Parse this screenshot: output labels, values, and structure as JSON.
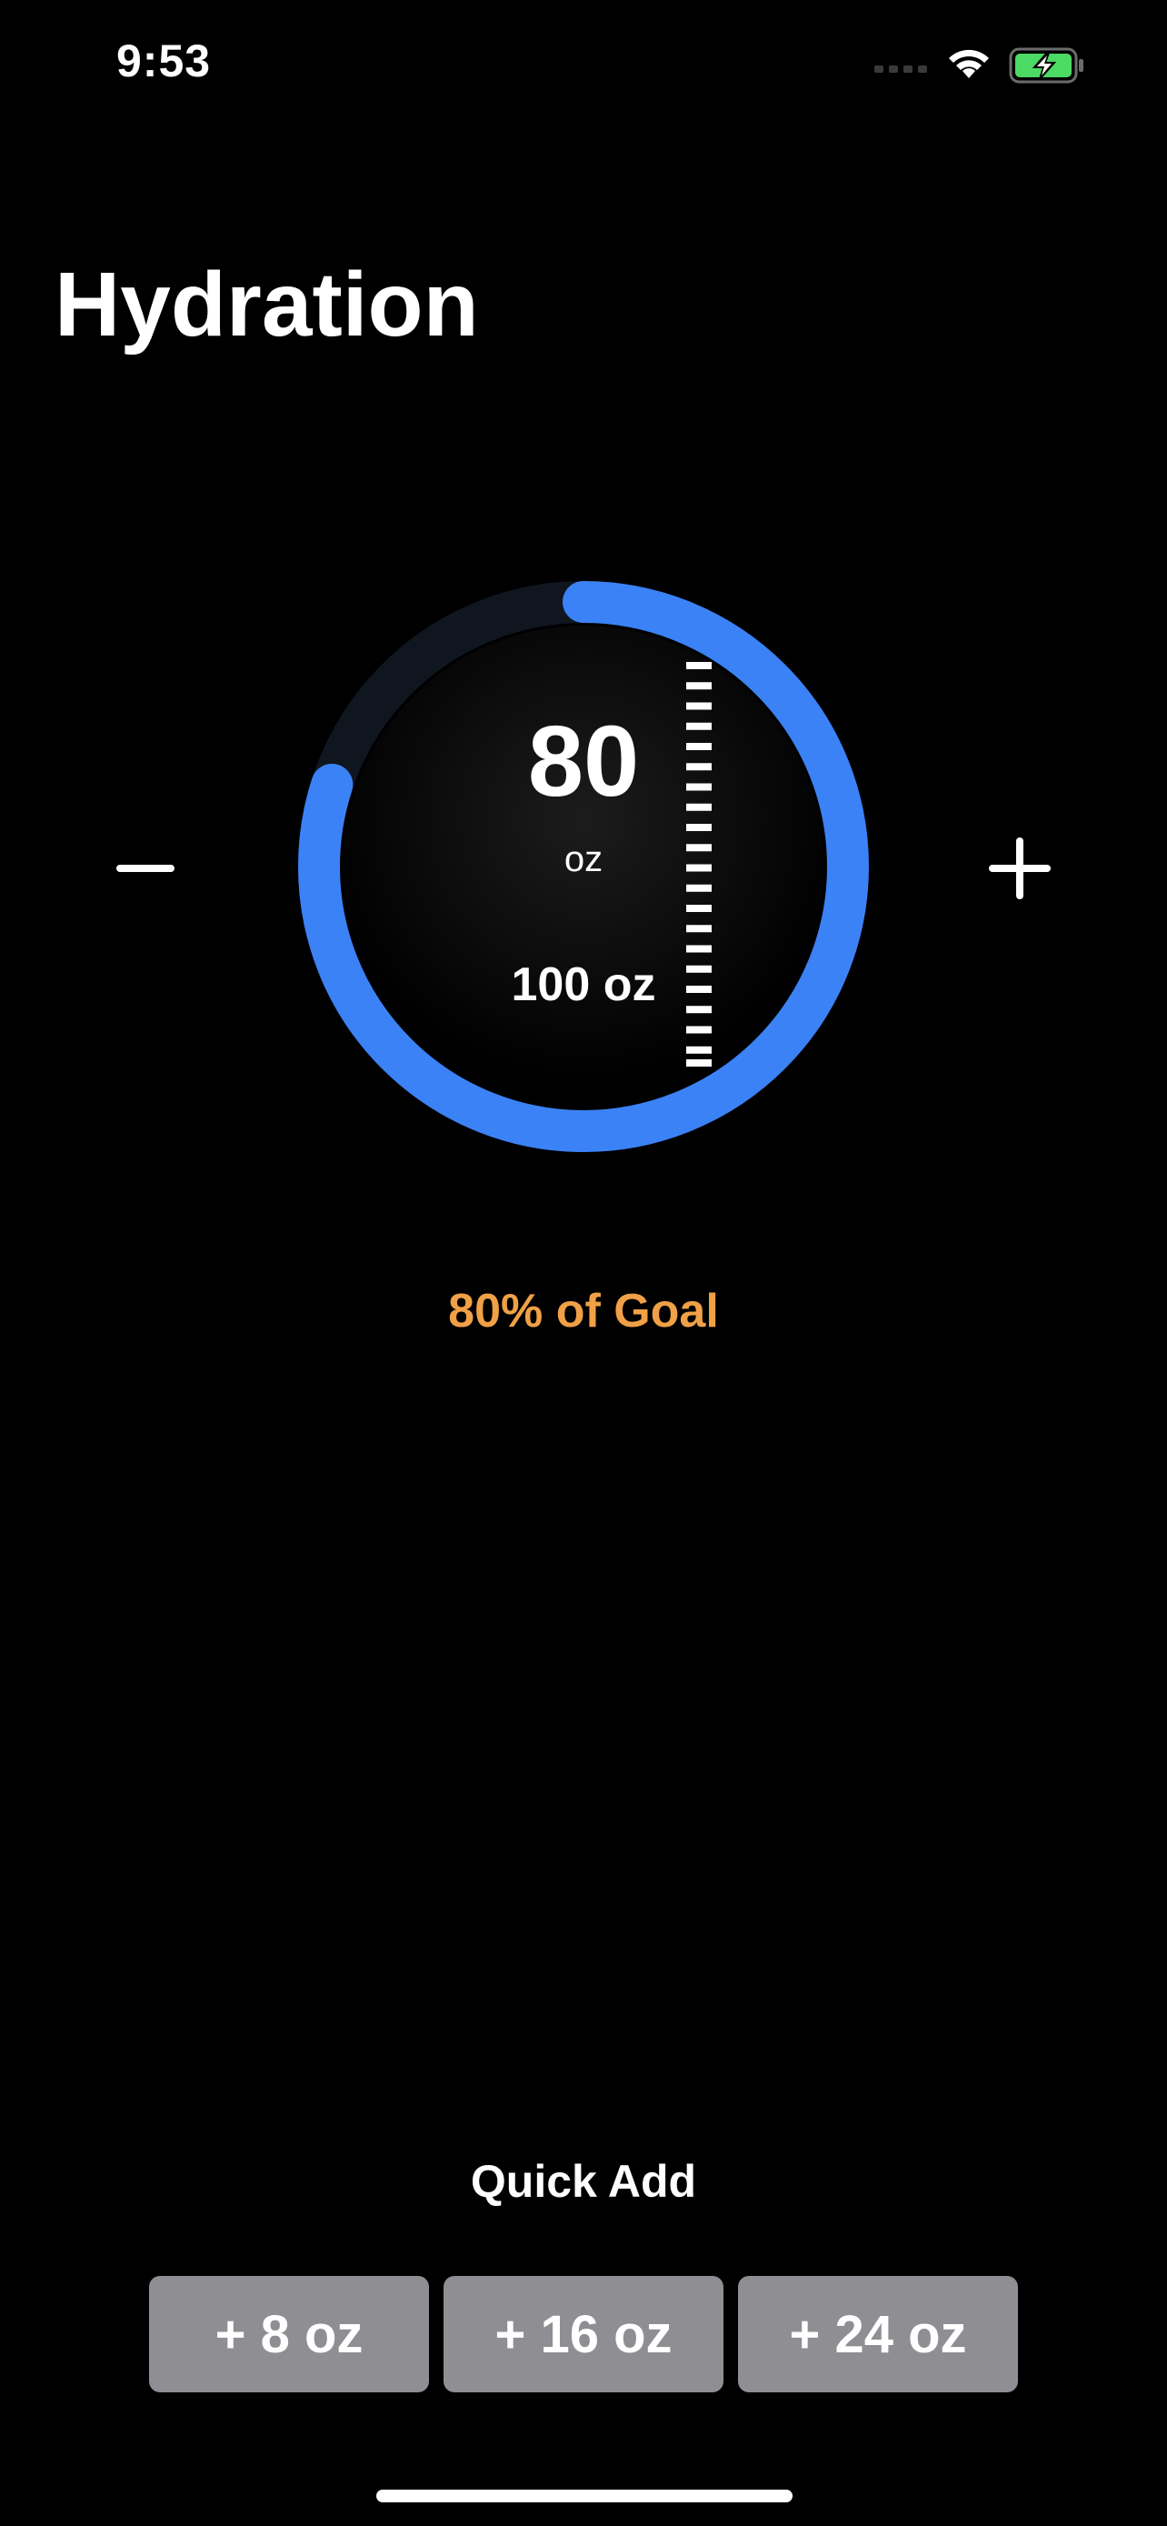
{
  "status_bar": {
    "time": "9:53",
    "icons": [
      "signal-icon",
      "wifi-icon",
      "battery-charging-icon"
    ],
    "battery_color": "#4cd964"
  },
  "header": {
    "title": "Hydration"
  },
  "gauge": {
    "current_value": "80",
    "unit": "oz",
    "goal_label": "100 oz",
    "progress": 0.8,
    "ring_color": "#3b82f6",
    "track_color": "#0f1620"
  },
  "controls": {
    "decrement_icon": "minus-icon",
    "increment_icon": "plus-icon"
  },
  "summary": {
    "percent_label": "80% of Goal",
    "percent_color": "#f0a046"
  },
  "quick_add": {
    "title": "Quick Add",
    "buttons": [
      {
        "label": "+ 8 oz"
      },
      {
        "label": "+ 16 oz"
      },
      {
        "label": "+ 24 oz"
      }
    ],
    "button_color": "#8e8e93"
  }
}
